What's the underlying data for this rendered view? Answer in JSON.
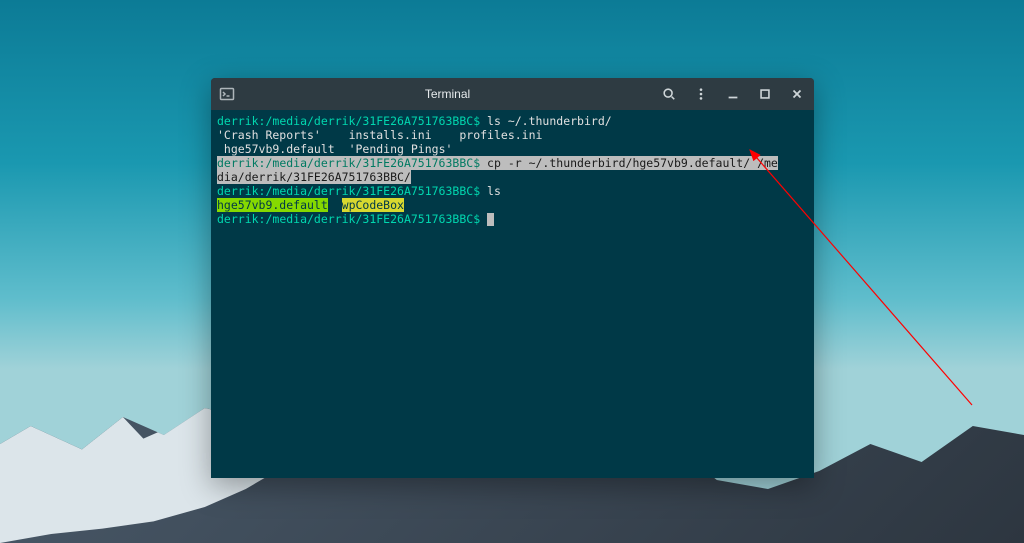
{
  "window": {
    "title": "Terminal"
  },
  "terminal": {
    "line1": {
      "user": "derrik",
      "path": ":/media/derrik/31FE26A751763BBC",
      "dollar": "$",
      "cmd": " ls ~/.thunderbird/"
    },
    "line2": {
      "f1": "'Crash Reports'",
      "sp1": "    ",
      "f2": "installs.ini",
      "sp2": "    ",
      "f3": "profiles.ini"
    },
    "line3": {
      "f1": " hge57vb9.default",
      "sp1": "  ",
      "f2": "'Pending Pings'"
    },
    "line4": {
      "user": "derrik",
      "path": ":/media/derrik/31FE26A751763BBC",
      "dollar": "$",
      "cmd_sel": " cp -r ~/.thunderbird/hge57vb9.default/ /me"
    },
    "line5": {
      "cmd_sel": "dia/derrik/31FE26A751763BBC/"
    },
    "line6": {
      "user": "derrik",
      "path": ":/media/derrik/31FE26A751763BBC",
      "dollar": "$",
      "cmd": " ls"
    },
    "line7": {
      "hl1": "hge57vb9.default",
      "sp1": "  ",
      "hl2": "wpCodeBox"
    },
    "line8": {
      "user": "derrik",
      "path": ":/media/derrik/31FE26A751763BBC",
      "dollar": "$",
      "cmd": " "
    }
  }
}
